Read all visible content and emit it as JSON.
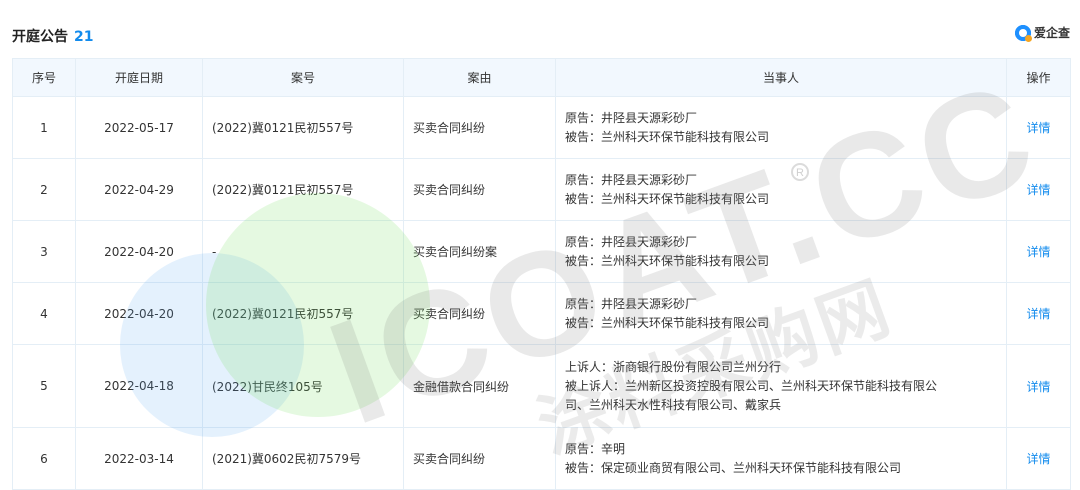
{
  "header": {
    "title": "开庭公告",
    "count": "21",
    "brand": "爱企查"
  },
  "table": {
    "columns": [
      "序号",
      "开庭日期",
      "案号",
      "案由",
      "当事人",
      "操作"
    ],
    "rows": [
      {
        "no": "1",
        "date": "2022-05-17",
        "case_no": "(2022)冀0121民初557号",
        "cause": "买卖合同纠纷",
        "parties": [
          "原告：井陉县天源彩砂厂",
          "被告：兰州科天环保节能科技有限公司"
        ],
        "action": "详情"
      },
      {
        "no": "2",
        "date": "2022-04-29",
        "case_no": "(2022)冀0121民初557号",
        "cause": "买卖合同纠纷",
        "parties": [
          "原告：井陉县天源彩砂厂",
          "被告：兰州科天环保节能科技有限公司"
        ],
        "action": "详情"
      },
      {
        "no": "3",
        "date": "2022-04-20",
        "case_no": "-",
        "cause": "买卖合同纠纷案",
        "parties": [
          "原告：井陉县天源彩砂厂",
          "被告：兰州科天环保节能科技有限公司"
        ],
        "action": "详情"
      },
      {
        "no": "4",
        "date": "2022-04-20",
        "case_no": "(2022)冀0121民初557号",
        "cause": "买卖合同纠纷",
        "parties": [
          "原告：井陉县天源彩砂厂",
          "被告：兰州科天环保节能科技有限公司"
        ],
        "action": "详情"
      },
      {
        "no": "5",
        "date": "2022-04-18",
        "case_no": "(2022)甘民终105号",
        "cause": "金融借款合同纠纷",
        "parties": [
          "上诉人：浙商银行股份有限公司兰州分行",
          "被上诉人：兰州新区投资控股有限公司、兰州科天环保节能科技有限公",
          "司、兰州科天水性科技有限公司、戴家兵"
        ],
        "action": "详情"
      },
      {
        "no": "6",
        "date": "2022-03-14",
        "case_no": "(2021)冀0602民初7579号",
        "cause": "买卖合同纠纷",
        "parties": [
          "原告：辛明",
          "被告：保定硕业商贸有限公司、兰州科天环保节能科技有限公司"
        ],
        "action": "详情"
      }
    ]
  },
  "watermark": {
    "latin": "ICOAT.CC",
    "cn": "涂料采购网",
    "mark": "R"
  },
  "colors": {
    "accent": "#128bed",
    "header_bg": "#f2f8fe",
    "border": "#e4eef6"
  }
}
